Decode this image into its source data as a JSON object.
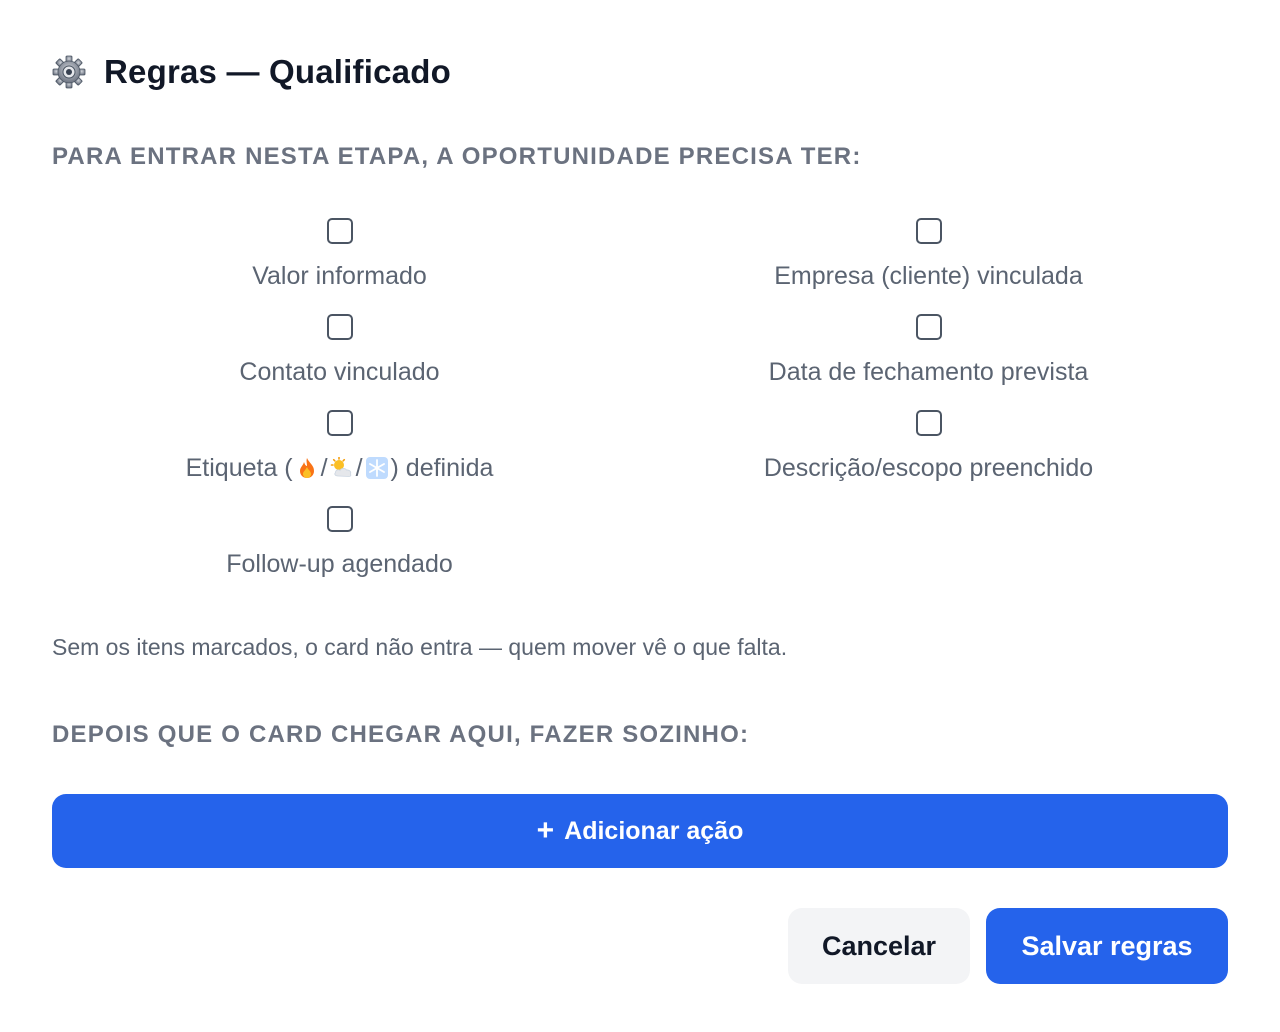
{
  "header": {
    "icon": "gear-icon",
    "title": "Regras — Qualificado"
  },
  "entry_rules": {
    "section_title": "PARA ENTRAR NESTA ETAPA, A OPORTUNIDADE PRECISA TER:",
    "items": [
      {
        "label": "Valor informado",
        "checked": false
      },
      {
        "label": "Empresa (cliente) vinculada",
        "checked": false
      },
      {
        "label": "Contato vinculado",
        "checked": false
      },
      {
        "label": "Data de fechamento prevista",
        "checked": false
      },
      {
        "label_prefix": "Etiqueta (",
        "label_sep": "/",
        "label_suffix": ") definida",
        "emojis": [
          "fire-icon",
          "sun-cloud-icon",
          "snowflake-icon"
        ],
        "checked": false
      },
      {
        "label": "Descrição/escopo preenchido",
        "checked": false
      },
      {
        "label": "Follow-up agendado",
        "checked": false
      }
    ],
    "hint": "Sem os itens marcados, o card não entra — quem mover vê o que falta."
  },
  "after_rules": {
    "section_title": "DEPOIS QUE O CARD CHEGAR AQUI, FAZER SOZINHO:",
    "add_action_label": "Adicionar ação",
    "add_action_icon": "+"
  },
  "footer": {
    "cancel_label": "Cancelar",
    "save_label": "Salvar regras"
  },
  "colors": {
    "primary": "#2563eb",
    "muted_text": "#6b7280",
    "title_text": "#111827"
  }
}
